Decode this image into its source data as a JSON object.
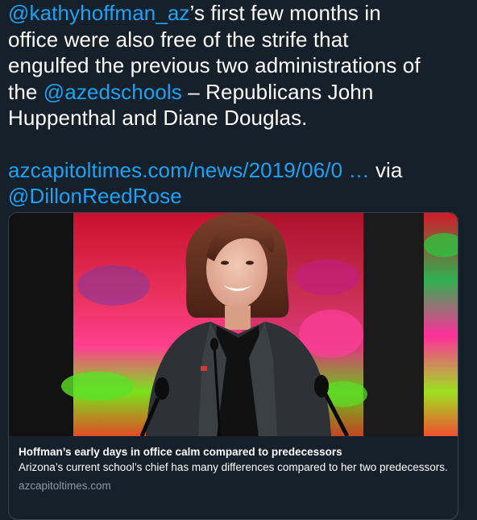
{
  "tweet": {
    "lines": [
      {
        "mention": "@kathyhoffman_az",
        "text": "’s first few months in"
      },
      {
        "text": "office were also free of the strife that"
      },
      {
        "text": "engulfed the previous two administrations of"
      },
      {
        "pre": "the ",
        "mention": "@azedschools",
        "text": " – Republicans John"
      },
      {
        "text": "Huppenthal and Diane Douglas."
      }
    ],
    "link_text": "azcapitoltimes.com/news/2019/06/0",
    "link_ellipsis": " …",
    "via_text": " via",
    "via_mention": "@DillonReedRose"
  },
  "card": {
    "title": "Hoffman’s early days in office calm compared to predecessors",
    "description": "Arizona’s current school’s chief has many differences compared to her two predecessors.",
    "domain": "azcapitoltimes.com"
  },
  "colors": {
    "background": "#15202b",
    "link": "#1da1f2",
    "border": "#38444d",
    "muted": "#8899a6"
  }
}
